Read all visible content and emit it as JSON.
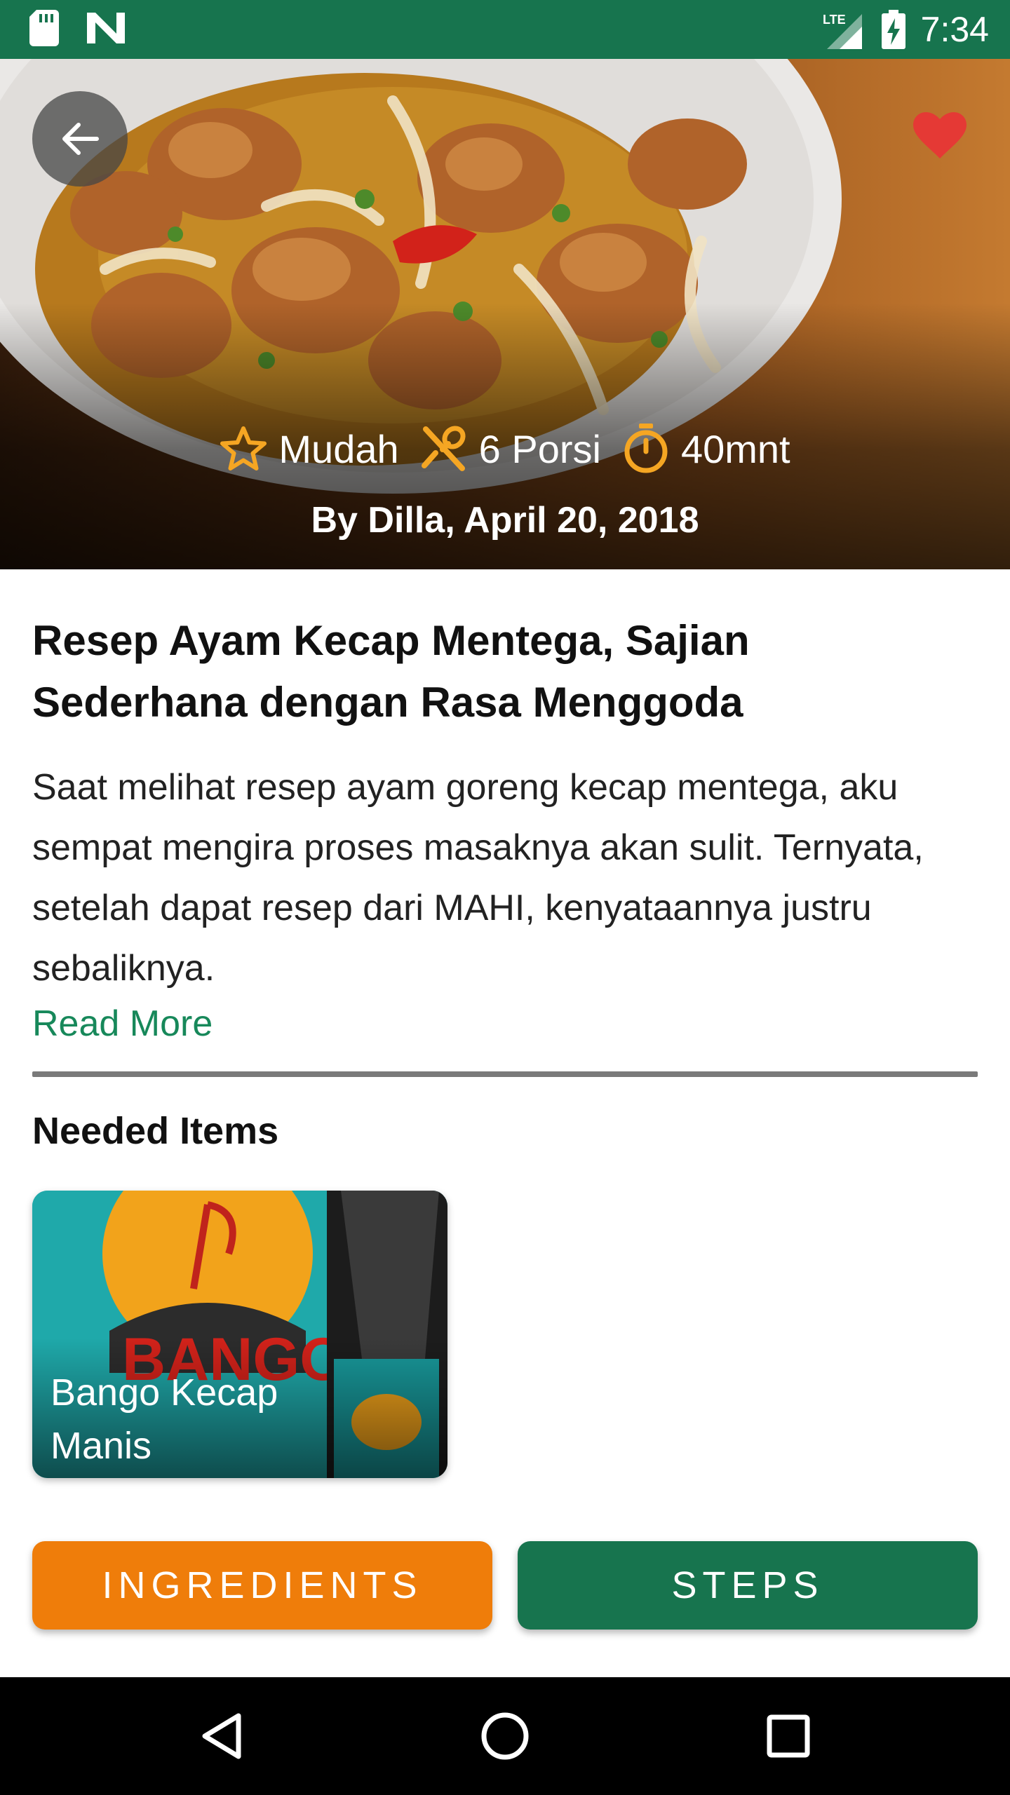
{
  "status_bar": {
    "time": "7:34",
    "network": "LTE"
  },
  "hero": {
    "meta": [
      {
        "icon": "star-icon",
        "label": "Mudah"
      },
      {
        "icon": "utensils-icon",
        "label": "6 Porsi"
      },
      {
        "icon": "timer-icon",
        "label": "40mnt"
      }
    ],
    "byline": "By Dilla, April 20, 2018",
    "favorite_color": "#e53935"
  },
  "article": {
    "title": "Resep Ayam Kecap Mentega, Sajian Sederhana dengan Rasa Menggoda",
    "description": "Saat melihat resep ayam goreng kecap mentega, aku sempat mengira proses masaknya akan sulit. Ternyata, setelah dapat resep dari MAHI, kenyataannya justru sebaliknya.",
    "read_more": "Read More"
  },
  "needed_items": {
    "title": "Needed Items",
    "items": [
      {
        "name": "Bango Kecap Manis"
      }
    ]
  },
  "actions": {
    "ingredients_label": "INGREDIENTS",
    "steps_label": "STEPS"
  },
  "colors": {
    "primary_green": "#17744e",
    "accent_orange": "#ef7d0a",
    "link_green": "#17885a",
    "icon_gold": "#f5a623"
  }
}
